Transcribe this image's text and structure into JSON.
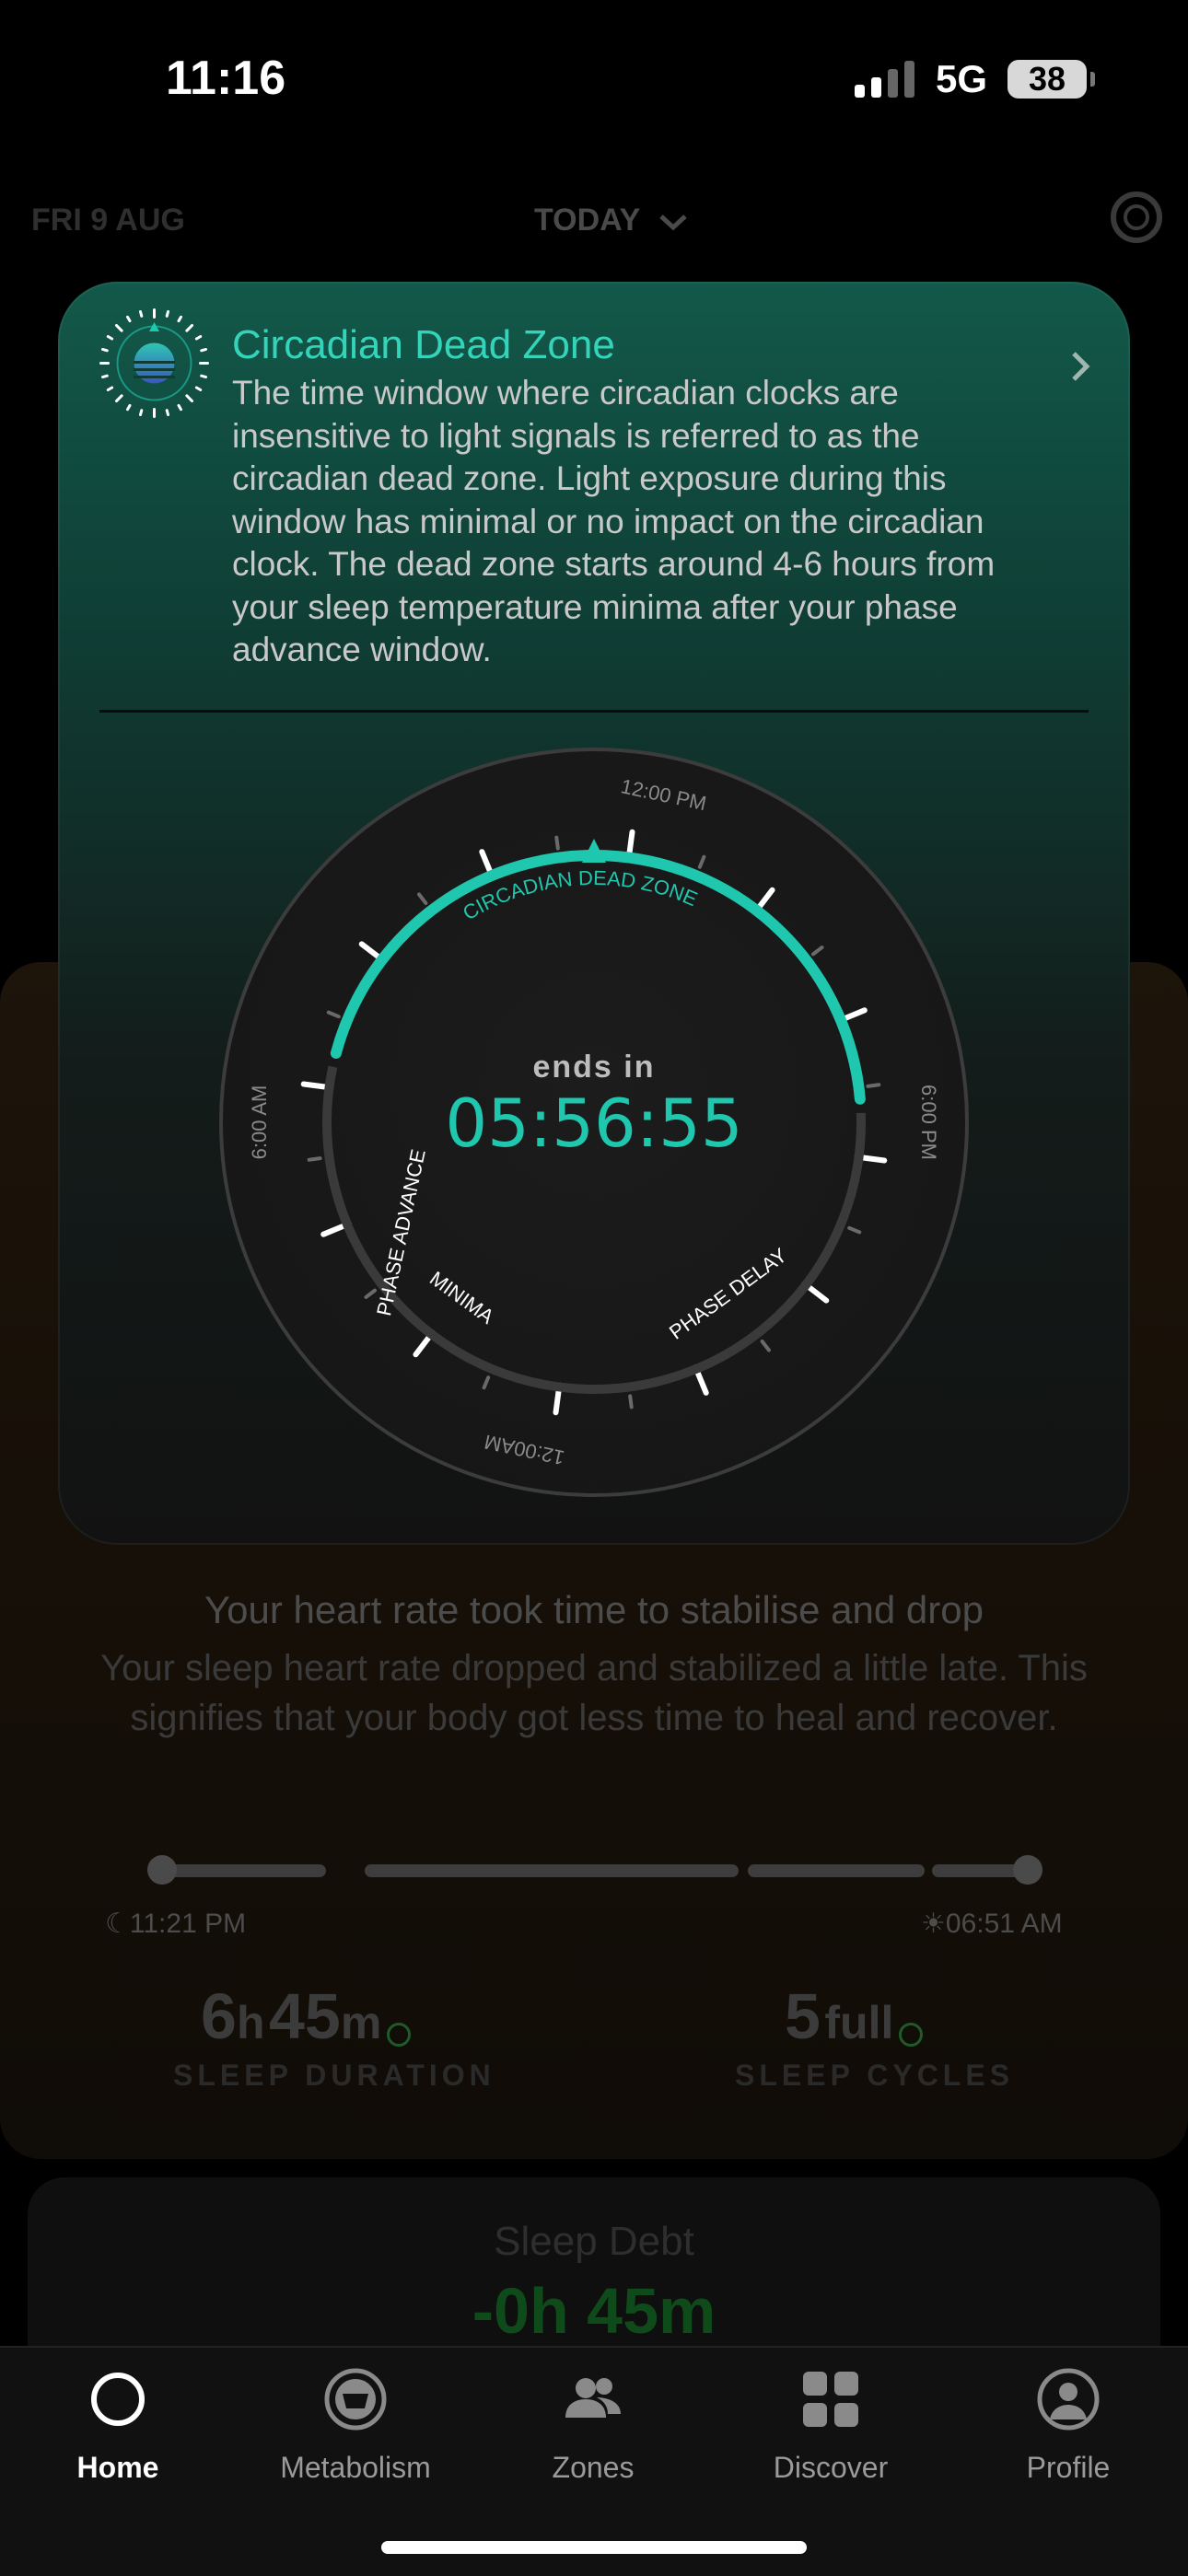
{
  "status_bar": {
    "time": "11:16",
    "network": "5G",
    "battery": "38"
  },
  "header": {
    "date": "FRI 9 AUG",
    "selector": "TODAY",
    "selector_icon": "chevron-down-icon",
    "right_icon": "ring-icon"
  },
  "card": {
    "title": "Circadian Dead Zone",
    "description": "The time window where circadian clocks are insensitive to light signals is referred to as the circadian dead zone. Light exposure during this window has minimal or no impact on the circadian clock. The dead zone starts around 4-6 hours from your sleep temperature minima after your phase advance window.",
    "icon": "sun-dial-icon",
    "chevron_icon": "chevron-right-icon",
    "dial": {
      "top_label": "12:00 PM",
      "right_label": "6:00 PM",
      "bottom_label": "12:00AM",
      "left_label": "6:00 AM",
      "active_zone": "CIRCADIAN DEAD ZONE",
      "zone_phase_advance": "PHASE ADVANCE",
      "zone_minima": "MINIMA",
      "zone_phase_delay": "PHASE DELAY",
      "countdown_caption": "ends in",
      "countdown": "05:56:55",
      "accent_color": "#1fc7ae"
    }
  },
  "sleep_card": {
    "title": "Your heart rate took time to stabilise and drop",
    "description": "Your sleep heart rate dropped and stabilized a little late. This signifies that your body got less time to heal and recover.",
    "start_time": "11:21 PM",
    "end_time": "06:51 AM",
    "duration_h": "6",
    "duration_h_unit": "h",
    "duration_m": "45",
    "duration_m_unit": "m",
    "duration_label": "SLEEP DURATION",
    "cycles_value": "5",
    "cycles_unit": "full",
    "cycles_label": "SLEEP CYCLES"
  },
  "sleep_debt": {
    "title": "Sleep Debt",
    "value": "-0h 45m"
  },
  "nav": [
    {
      "label": "Home",
      "icon": "home-ring-icon",
      "active": true
    },
    {
      "label": "Metabolism",
      "icon": "metabolism-icon",
      "active": false
    },
    {
      "label": "Zones",
      "icon": "zones-people-icon",
      "active": false
    },
    {
      "label": "Discover",
      "icon": "discover-grid-icon",
      "active": false
    },
    {
      "label": "Profile",
      "icon": "profile-icon",
      "active": false
    }
  ]
}
